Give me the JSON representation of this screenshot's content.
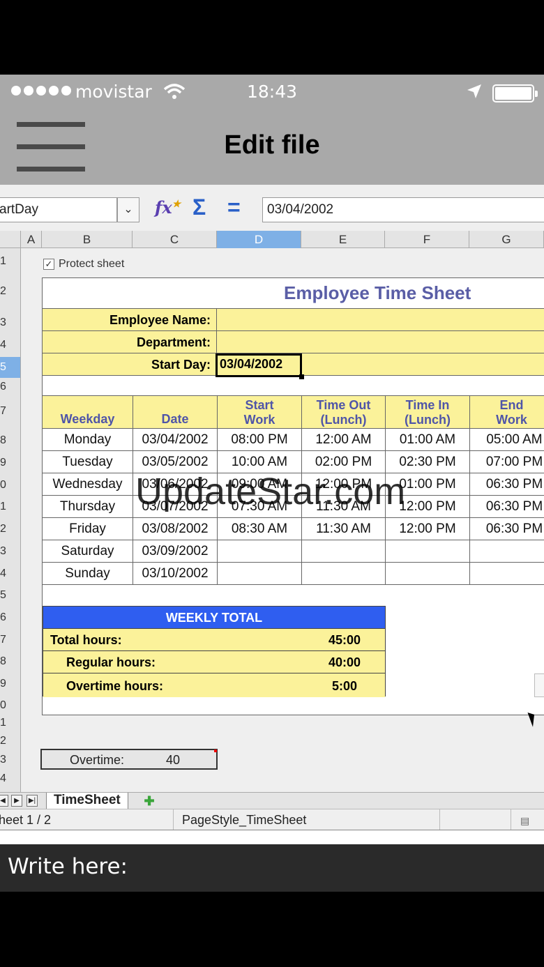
{
  "status": {
    "carrier": "movistar",
    "time": "18:43"
  },
  "nav": {
    "title": "Edit file"
  },
  "formula_bar": {
    "name_box": "artDay",
    "value": "03/04/2002"
  },
  "columns": [
    "A",
    "B",
    "C",
    "D",
    "E",
    "F",
    "G"
  ],
  "selected_column": "D",
  "rows": [
    "1",
    "2",
    "3",
    "4",
    "5",
    "6",
    "7",
    "8",
    "9",
    "0",
    "1",
    "2",
    "3",
    "4",
    "5",
    "6",
    "7",
    "8",
    "9",
    "0",
    "1",
    "2",
    "3",
    "4"
  ],
  "sheet": {
    "protect_label": "Protect sheet",
    "title": "Employee Time Sheet",
    "fields": [
      {
        "label": "Employee Name:",
        "value": ""
      },
      {
        "label": "Department:",
        "value": ""
      },
      {
        "label": "Start Day:",
        "value": "03/04/2002"
      }
    ],
    "headers": [
      "Weekday",
      "Date",
      "Start Work",
      "Time Out (Lunch)",
      "Time In (Lunch)",
      "End Work"
    ],
    "rows": [
      [
        "Monday",
        "03/04/2002",
        "08:00 PM",
        "12:00 AM",
        "01:00 AM",
        "05:00 AM"
      ],
      [
        "Tuesday",
        "03/05/2002",
        "10:00 AM",
        "02:00 PM",
        "02:30 PM",
        "07:00 PM"
      ],
      [
        "Wednesday",
        "03/06/2002",
        "09:00 AM",
        "12:00 PM",
        "01:00 PM",
        "06:30 PM"
      ],
      [
        "Thursday",
        "03/07/2002",
        "07:30 AM",
        "11:30 AM",
        "12:00 PM",
        "06:30 PM"
      ],
      [
        "Friday",
        "03/08/2002",
        "08:30 AM",
        "11:30 AM",
        "12:00 PM",
        "06:30 PM"
      ],
      [
        "Saturday",
        "03/09/2002",
        "",
        "",
        "",
        ""
      ],
      [
        "Sunday",
        "03/10/2002",
        "",
        "",
        "",
        ""
      ]
    ],
    "weekly": {
      "title": "WEEKLY TOTAL",
      "rows": [
        {
          "label": "Total hours:",
          "value": "45:00"
        },
        {
          "label": "Regular hours:",
          "value": "40:00"
        },
        {
          "label": "Overtime hours:",
          "value": "5:00"
        }
      ]
    },
    "overtime": {
      "label": "Overtime:",
      "value": "40"
    }
  },
  "tabs": {
    "active": "TimeSheet"
  },
  "statusbar": {
    "sheet": "heet 1 / 2",
    "page_style": "PageStyle_TimeSheet"
  },
  "watermark": "UpdateStar.com",
  "input": {
    "placeholder": "Write here:"
  },
  "colors": {
    "accent_yellow": "#fbf29a",
    "weekly_blue": "#2f5ef0",
    "title_purple": "#5a5ea6"
  }
}
